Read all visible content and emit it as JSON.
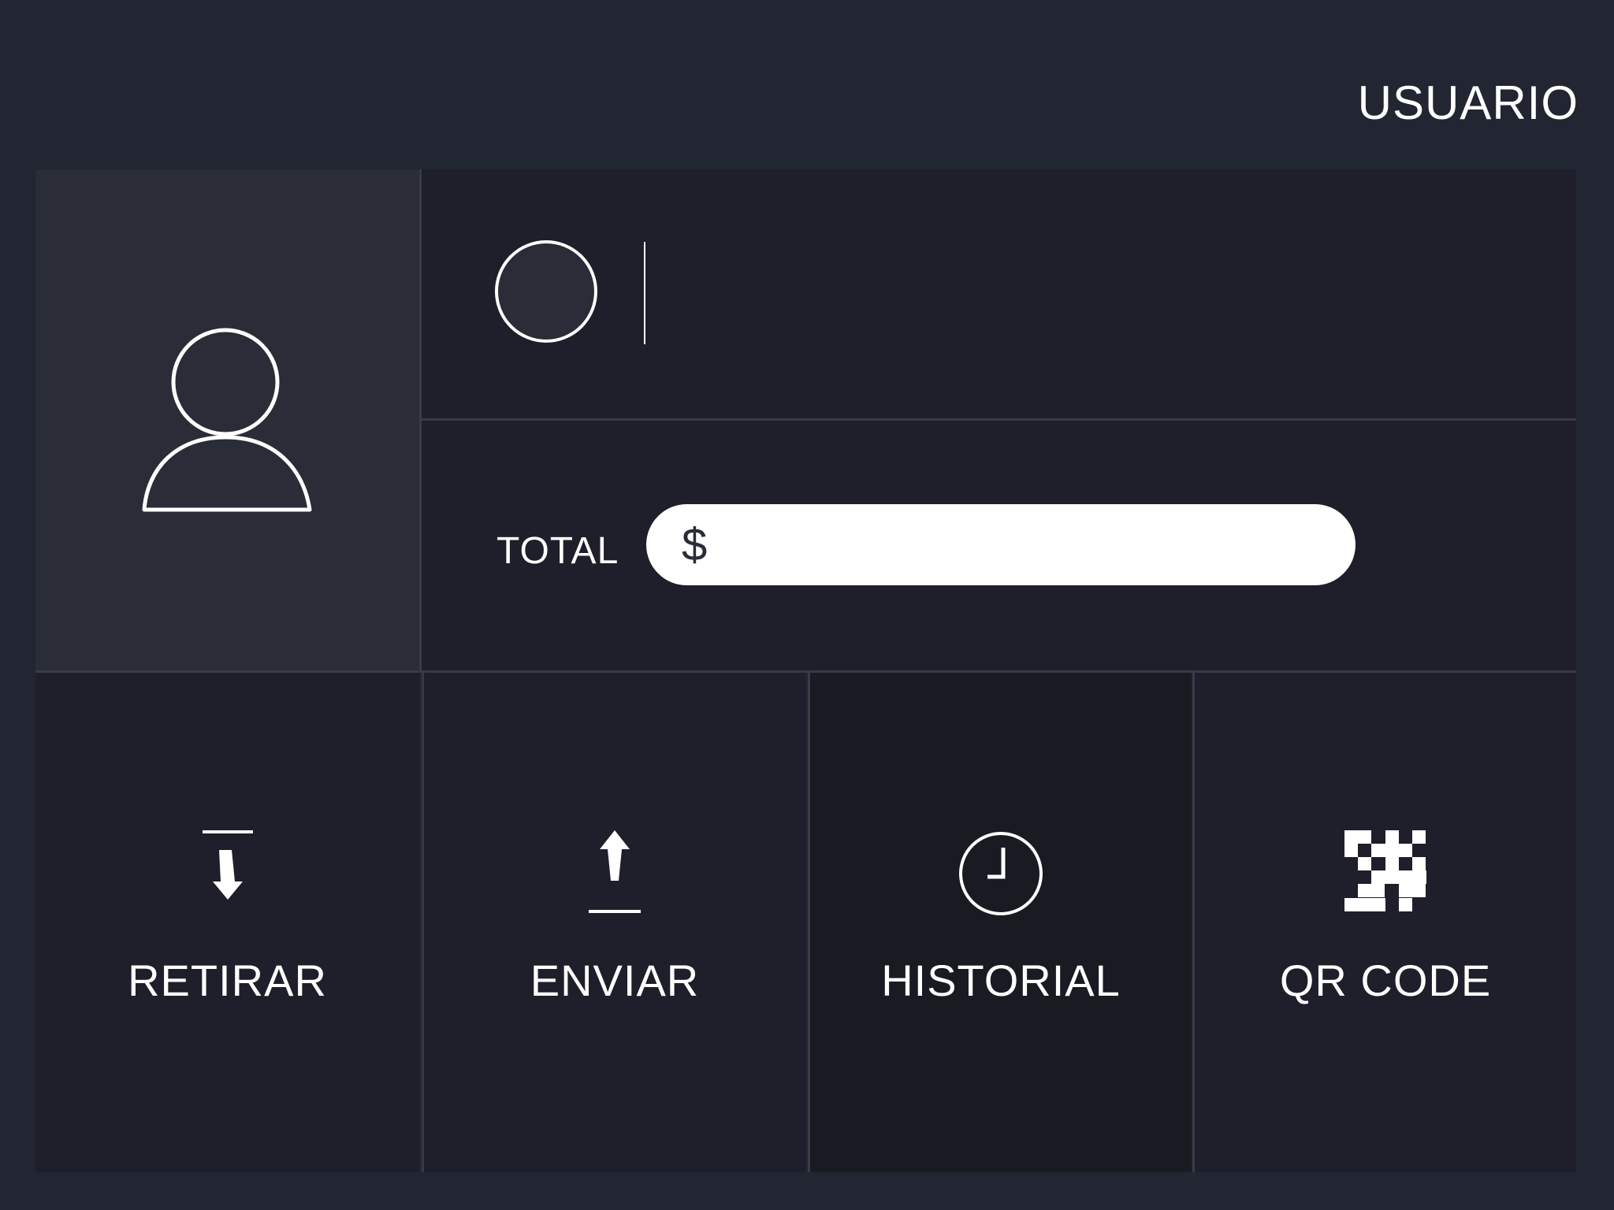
{
  "header": {
    "user_label": "USUARIO"
  },
  "account": {
    "avatar_icon": "user-icon"
  },
  "total": {
    "label": "TOTAL",
    "currency": "$",
    "value": ""
  },
  "actions": [
    {
      "label": "RETIRAR",
      "icon": "withdraw-icon"
    },
    {
      "label": "ENVIAR",
      "icon": "send-icon"
    },
    {
      "label": "HISTORIAL",
      "icon": "clock-icon"
    },
    {
      "label": "QR CODE",
      "icon": "qr-code-icon"
    }
  ],
  "colors": {
    "background": "#222632",
    "panel": "#1e1f2a",
    "avatar_panel": "#2a2c38",
    "accent": "#ffffff"
  }
}
